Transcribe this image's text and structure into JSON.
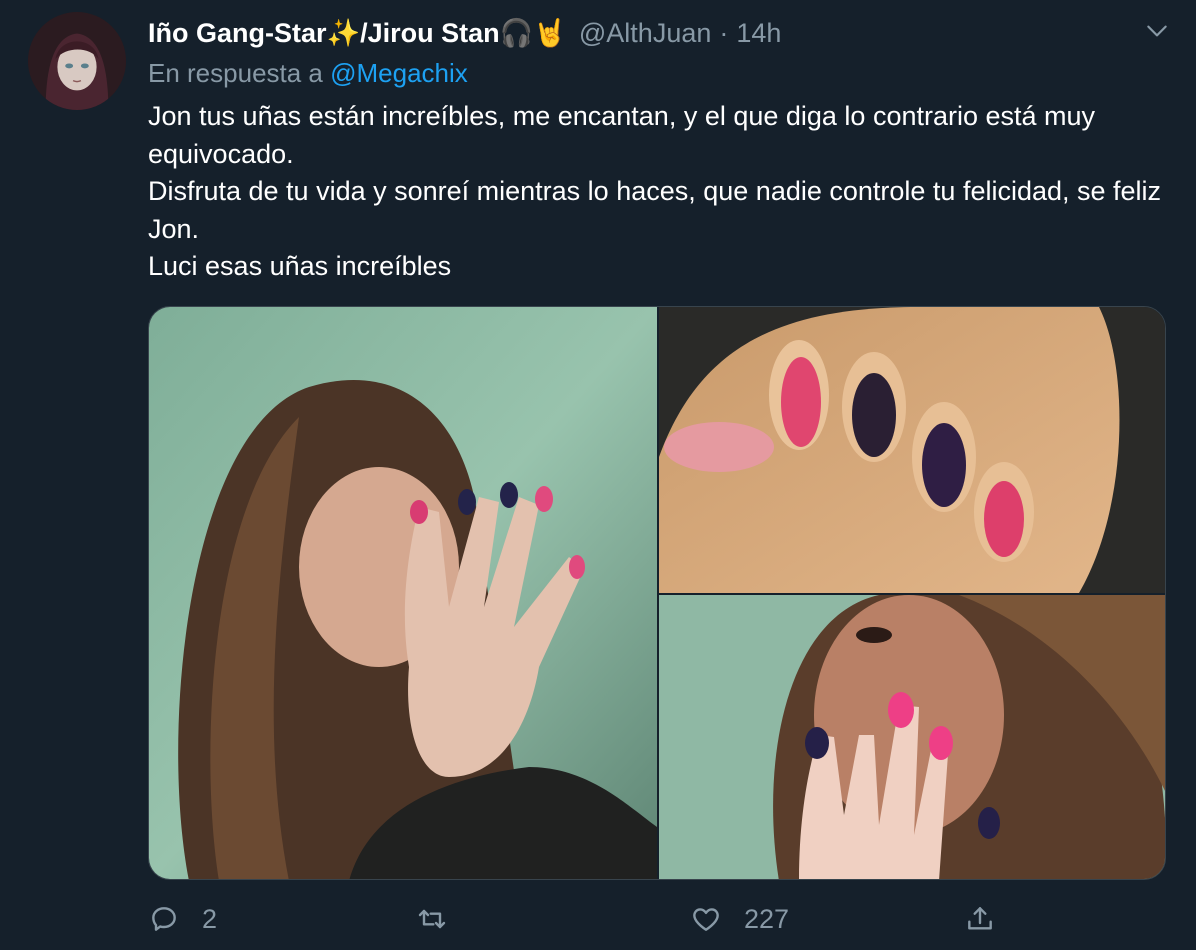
{
  "tweet": {
    "author": {
      "display_name": "Iño Gang-Star✨/Jirou Stan🎧🤘",
      "handle": "@AlthJuan",
      "separator": "·",
      "time": "14h",
      "avatar_icon": "avatar-anime-character"
    },
    "reply": {
      "prefix": "En respuesta a",
      "mention": "@Megachix"
    },
    "text_lines": [
      "Jon tus uñas están increíbles, me encantan, y el que diga lo contrario está muy equivocado.",
      "Disfruta de tu vida y sonreí mientras lo haces, que nadie controle tu felicidad, se feliz Jon.",
      "Luci esas uñas increíbles"
    ],
    "media": [
      {
        "icon": "photo-selfie-painted-nails"
      },
      {
        "icon": "photo-closeup-painted-nails"
      },
      {
        "icon": "photo-face-painted-nails"
      }
    ],
    "actions": {
      "reply": {
        "icon": "reply-icon",
        "count": "2"
      },
      "retweet": {
        "icon": "retweet-icon",
        "count": ""
      },
      "like": {
        "icon": "heart-icon",
        "count": "227"
      },
      "share": {
        "icon": "share-icon",
        "count": ""
      }
    },
    "menu_icon": "chevron-down-icon",
    "colors": {
      "background": "#15202b",
      "secondary_text": "#8899a6",
      "link": "#1da1f2",
      "border": "#38444d"
    }
  }
}
